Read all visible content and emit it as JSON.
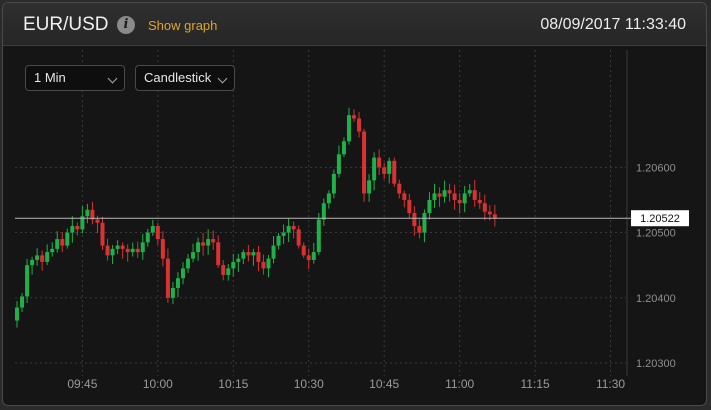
{
  "header": {
    "pair": "EUR/USD",
    "info_icon": "info-icon",
    "show_graph": "Show graph",
    "timestamp": "08/09/2017 11:33:40"
  },
  "controls": {
    "interval": "1 Min",
    "chart_type_select": "Candlestick"
  },
  "colors": {
    "up": "#1fb04a",
    "down": "#d93232",
    "accent": "#e0a526"
  },
  "chart_data": {
    "type": "candlestick",
    "current_price": "1.20522",
    "current_value": 1.20522,
    "y_ticks": [
      "1.20600",
      "1.20500",
      "1.20400",
      "1.20300"
    ],
    "ylim": [
      1.2028,
      1.2078
    ],
    "x_ticks": [
      "09:45",
      "10:00",
      "10:15",
      "10:30",
      "10:45",
      "11:00",
      "11:15",
      "11:30"
    ],
    "x_tick_minutes": [
      585,
      600,
      615,
      630,
      645,
      660,
      675,
      690
    ],
    "start_minute": 572,
    "grid": true,
    "close": [
      1.20385,
      1.20402,
      1.2045,
      1.20458,
      1.20465,
      1.20455,
      1.2047,
      1.20475,
      1.2049,
      1.2048,
      1.205,
      1.2051,
      1.20505,
      1.20525,
      1.20535,
      1.2052,
      1.20515,
      1.2048,
      1.20465,
      1.20475,
      1.2048,
      1.20475,
      1.2047,
      1.20475,
      1.2047,
      1.20485,
      1.205,
      1.2051,
      1.2049,
      1.2046,
      1.204,
      1.20415,
      1.2043,
      1.20445,
      1.2046,
      1.2047,
      1.20485,
      1.2048,
      1.2049,
      1.20485,
      1.2045,
      1.20435,
      1.20445,
      1.20455,
      1.2046,
      1.2047,
      1.20465,
      1.2047,
      1.20455,
      1.20445,
      1.2046,
      1.2048,
      1.20495,
      1.205,
      1.2051,
      1.20505,
      1.2048,
      1.20465,
      1.20458,
      1.2047,
      1.2052,
      1.20545,
      1.2056,
      1.2059,
      1.2062,
      1.2064,
      1.2068,
      1.20675,
      1.20655,
      1.2056,
      1.2058,
      1.20615,
      1.206,
      1.2059,
      1.2061,
      1.20575,
      1.2056,
      1.2055,
      1.2053,
      1.2051,
      1.205,
      1.2053,
      1.2055,
      1.2056,
      1.20555,
      1.20565,
      1.2056,
      1.2055,
      1.20545,
      1.2056,
      1.20565,
      1.2055,
      1.20545,
      1.20532,
      1.20528,
      1.20522
    ]
  }
}
